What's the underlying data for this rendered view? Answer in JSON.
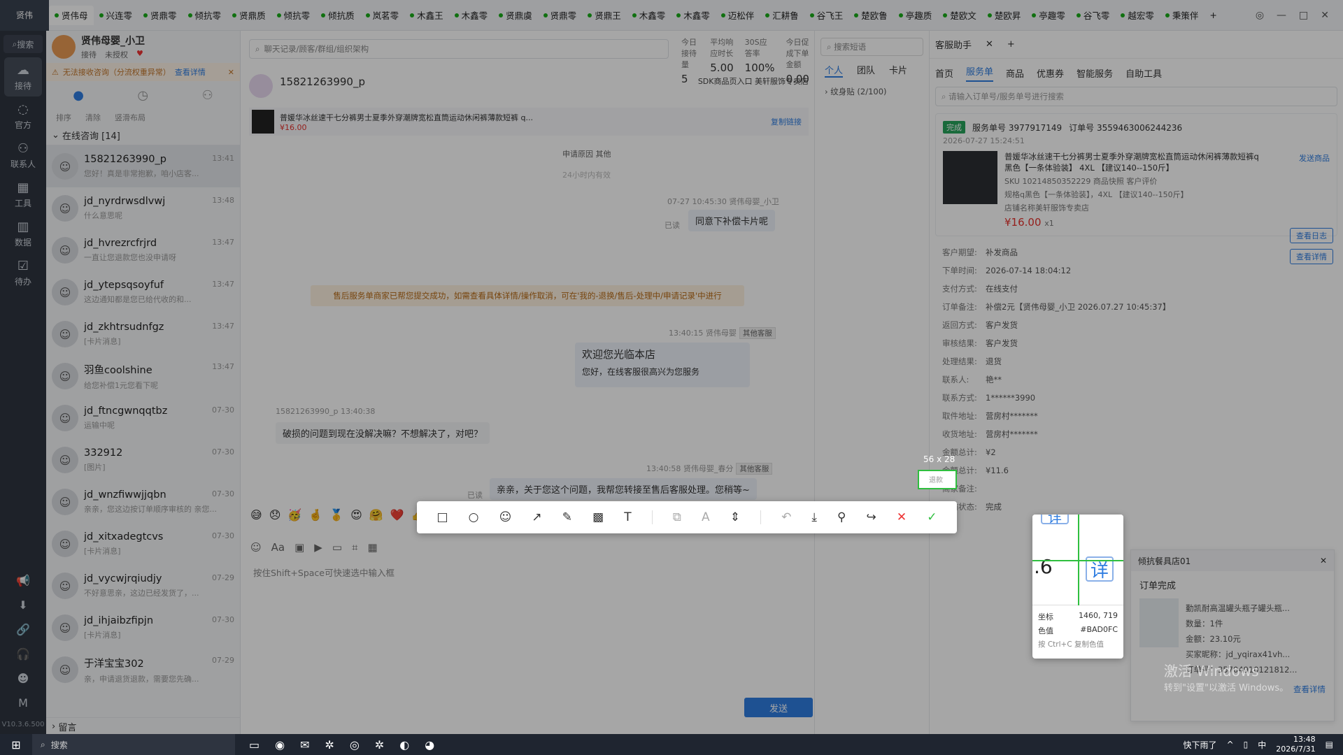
{
  "topbar": {
    "logo": "贤伟",
    "tabs": [
      "贤伟母",
      "兴连零",
      "贤鼎零",
      "倾抗零",
      "贤鼎质",
      "倾抗零",
      "倾抗质",
      "岚茗零",
      "木鑫王",
      "木鑫零",
      "贤鼎虞",
      "贤鼎零",
      "贤鼎王",
      "木鑫零",
      "木鑫零",
      "迈松伴",
      "汇耕鲁",
      "谷飞王",
      "楚欧鲁",
      "亭趣质",
      "楚欧文",
      "楚欧昇",
      "亭趣零",
      "谷飞零",
      "越宏零",
      "秉策伴"
    ],
    "add": "+",
    "window": [
      "◎",
      "—",
      "□",
      "✕"
    ]
  },
  "nav": {
    "search": "搜索",
    "items": [
      "接待",
      "官方",
      "联系人",
      "工具",
      "数据",
      "待办"
    ],
    "version": "V10.3.6.500"
  },
  "agent": {
    "name": "贤伟母婴_小卫",
    "status": "接待",
    "auth": "未授权"
  },
  "warning": {
    "text": "无法接收咨询（分流权重异常）",
    "link": "查看详情"
  },
  "contacts": {
    "tools": [
      "排序",
      "清除",
      "竖滑布局"
    ],
    "group": "在线咨询 [14]",
    "items": [
      {
        "name": "15821263990_p",
        "time": "13:41",
        "msg": "您好！真是非常抱歉，咱小店客..."
      },
      {
        "name": "jd_nyrdrwsdlvwj",
        "time": "13:48",
        "msg": "什么意思呢"
      },
      {
        "name": "jd_hvrezrcfrjrd",
        "time": "13:47",
        "msg": "一直让您退款您也没申请呀"
      },
      {
        "name": "jd_ytepsqsoyfuf",
        "time": "13:47",
        "msg": "这边通知都是您已给代收的和..."
      },
      {
        "name": "jd_zkhtrsudnfgz",
        "time": "13:47",
        "msg": "[卡片消息]"
      },
      {
        "name": "羽鱼coolshine",
        "time": "13:47",
        "msg": "给您补偿1元您看下呢"
      },
      {
        "name": "jd_ftncgwnqqtbz",
        "time": "07-30",
        "msg": "运输中呢"
      },
      {
        "name": "332912",
        "time": "07-30",
        "msg": "[图片]"
      },
      {
        "name": "jd_wnzfiwwjjqbn",
        "time": "07-30",
        "msg": "亲亲，您这边按订单顺序审核的 亲您..."
      },
      {
        "name": "jd_xitxadegtcvs",
        "time": "07-30",
        "msg": "[卡片消息]"
      },
      {
        "name": "jd_vycwjrqiudjy",
        "time": "07-29",
        "msg": "不好意思亲，这边已经发货了，..."
      },
      {
        "name": "jd_ihjaibzfipjn",
        "time": "07-30",
        "msg": "[卡片消息]"
      },
      {
        "name": "于洋宝宝302",
        "time": "07-29",
        "msg": "亲，申请退货退款，需要您先确..."
      }
    ],
    "footer": "留言"
  },
  "chat": {
    "search": "聊天记录/顾客/群组/组织架构",
    "stats": [
      {
        "label": "今日接待量",
        "value": "5"
      },
      {
        "label": "平均响应时长",
        "value": "5.00"
      },
      {
        "label": "30S应答率",
        "value": "100%"
      },
      {
        "label": "今日促成下单金额",
        "value": "0.00"
      }
    ],
    "customer": "15821263990_p",
    "entry": "SDK商品页入口  美轩服饰专卖店",
    "product": {
      "title": "普媛华冰丝速干七分裤男士夏季外穿潮牌宽松直筒运动休闲裤薄款短裤 q...",
      "price": "¥16.00",
      "copy": "复制链接"
    },
    "msgs": {
      "reason": "申请原因   其他",
      "h24": "24小时内有效",
      "m1meta": "07-27 10:45:30  贤伟母婴_小卫",
      "m1": "同意下补偿卡片呢",
      "read": "已读",
      "sys": "售后服务单商家已帮您提交成功，如需查看具体详情/操作取消，可在'我的-退换/售后-处理中/申请记录'中进行",
      "m2meta": "13:40:15  贤伟母婴",
      "m2tag": "其他客服",
      "welcome1": "欢迎您光临本店",
      "welcome2": "您好，在线客服很高兴为您服务",
      "m3meta": "15821263990_p  13:40:38",
      "m3": "破损的问题到现在没解决嘛？不想解决了，对吧？",
      "m4meta": "13:40:58  贤伟母婴_春分",
      "m4tag": "其他客服",
      "m4": "亲亲，关于您这个问题，我帮您转接至售后客服处理。您稍等~",
      "read2": "已读"
    },
    "emojis": [
      "😅",
      "😞",
      "🥳",
      "🤞",
      "🥇",
      "😍",
      "🤗",
      "❤️",
      "👍",
      "🌹",
      "💝",
      "🥳",
      "🎁",
      "😔",
      "😄"
    ],
    "placeholder": "按住Shift+Space可快速选中输入框",
    "send": "发送"
  },
  "quick": {
    "search": "搜索短语",
    "tabs": [
      "个人",
      "团队",
      "卡片"
    ],
    "group": "纹身贴 (2/100)"
  },
  "rpanel": {
    "title": "客服助手",
    "subtabs": [
      "首页",
      "服务单",
      "商品",
      "优惠券",
      "智能服务",
      "自助工具"
    ],
    "search": "请输入订单号/服务单号进行搜索",
    "order": {
      "badge": "完成",
      "service_no": "服务单号 3977917149",
      "order_no": "订单号 3559463006244236",
      "time": "2026-07-27 15:24:51",
      "title": "普媛华冰丝速干七分裤男士夏季外穿潮牌宽松直筒运动休闲裤薄款短裤q黑色【一条体验装】 4XL 【建议140--150斤】",
      "sku": "SKU 10214850352229  商品快照  客户评价",
      "spec": "规格q黑色【一条体验装】，4XL 【建议140--150斤】",
      "shop": "店铺名称美轩服饰专卖店",
      "price": "¥16.00",
      "qty": "x1",
      "send": "发送商品"
    },
    "fields": [
      {
        "k": "客户期望:",
        "v": "补发商品"
      },
      {
        "k": "下单时间:",
        "v": "2026-07-14 18:04:12"
      },
      {
        "k": "支付方式:",
        "v": "在线支付"
      },
      {
        "k": "订单备注:",
        "v": "补偿2元【贤伟母婴_小卫 2026.07.27 10:45:37】"
      },
      {
        "k": "返回方式:",
        "v": "客户发货"
      },
      {
        "k": "审核结果:",
        "v": "客户发货"
      },
      {
        "k": "处理结果:",
        "v": "退货"
      },
      {
        "k": "联系人:",
        "v": "艳**"
      },
      {
        "k": "联系方式:",
        "v": "1******3990"
      },
      {
        "k": "取件地址:",
        "v": "营房村*******"
      },
      {
        "k": "收货地址:",
        "v": "营房村*******"
      },
      {
        "k": "金额总计:",
        "v": "¥2"
      },
      {
        "k": "金额总计:",
        "v": "¥11.6"
      },
      {
        "k": "商家备注:",
        "v": ""
      },
      {
        "k": "当前状态:",
        "v": "完成"
      }
    ],
    "btns": [
      "查看日志",
      "查看详情"
    ]
  },
  "notice": {
    "shop": "倾抗餐具店01",
    "title": "订单完成",
    "item": "勤凯耐高温罐头瓶子罐头瓶...",
    "qty": "数量：1件",
    "amount": "金额：23.10元",
    "buyer": "买家昵称：jd_yqirax41vh...",
    "order": "订单号：35704910121812...",
    "more": "查看详情"
  },
  "capture": {
    "size": "56 x 28",
    "coord_label": "坐标",
    "coord": "1460, 719",
    "color_label": "色值",
    "color": "#BAD0FC",
    "hint": "按 Ctrl+C 复制色值",
    "mag_left": ".6",
    "mag_btn": "详",
    "sel_text": "退款"
  },
  "taskbar": {
    "search": "搜索",
    "weather": "快下雨了",
    "ime": "中",
    "time": "13:48",
    "date": "2026/7/31"
  },
  "watermark": {
    "l1": "激活 Windows",
    "l2": "转到\"设置\"以激活 Windows。"
  }
}
